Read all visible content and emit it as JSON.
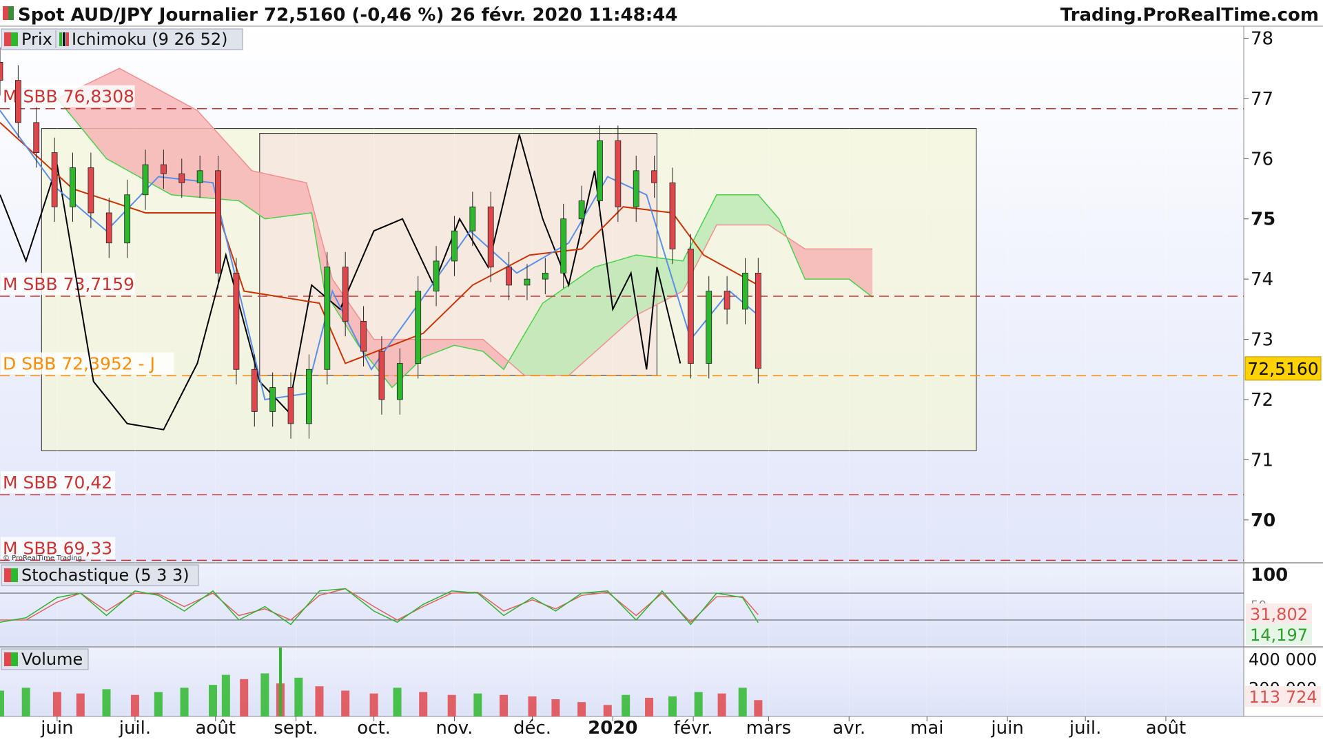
{
  "header": {
    "title": "Spot AUD/JPY Journalier 72,5160 (-0,46 %) 26 févr. 2020 11:48:44",
    "brand": "Trading.ProRealTime.com"
  },
  "legend": {
    "price": "Prix",
    "ichimoku": "Ichimoku (9 26 52)",
    "stochastic": "Stochastique (5 3 3)",
    "volume": "Volume",
    "copyright": "© ProRealTime Trading"
  },
  "colors": {
    "up": "#2eb82e",
    "down": "#e0474c",
    "kijun": "#cc3300",
    "tenkan": "#5b8ee6",
    "chikou": "#000000",
    "cloud_bull": "#bde9b5",
    "cloud_bear": "#f7b5b5",
    "level": "#cc3333",
    "current": "#ff8c00",
    "price_tag": "#ffd200"
  },
  "chart_data": [
    {
      "type": "candlestick",
      "ylim": [
        69.3,
        78.2
      ],
      "xlim": [
        "2019-05-10",
        "2020-08-31"
      ],
      "y_ticks": [
        "78",
        "77",
        "76",
        "75",
        "74",
        "73",
        "72",
        "71",
        "70"
      ],
      "bold_ticks": [
        "75",
        "70"
      ],
      "current_price": {
        "value": 72.516,
        "label": "72,5160"
      },
      "levels": [
        {
          "value": 76.8308,
          "label": "M SBB 76,8308",
          "kind": "major"
        },
        {
          "value": 73.7159,
          "label": "M SBB 73,7159",
          "kind": "major"
        },
        {
          "value": 72.3952,
          "label": "D SBB 72,3952 - J",
          "kind": "daily"
        },
        {
          "value": 70.42,
          "label": "M SBB 70,42",
          "kind": "major"
        },
        {
          "value": 69.33,
          "label": "M SBB 69,33",
          "kind": "major"
        }
      ],
      "zones": [
        {
          "from": "2019-05-26",
          "to": "2020-05-20",
          "low": 71.15,
          "high": 76.5
        },
        {
          "from": "2019-08-18",
          "to": "2020-01-18",
          "low": 72.4,
          "high": 76.42
        }
      ],
      "prices": [
        [
          "2019-05-10",
          77.3
        ],
        [
          "2019-05-17",
          76.6
        ],
        [
          "2019-05-24",
          76.1
        ],
        [
          "2019-05-31",
          75.2
        ],
        [
          "2019-06-07",
          75.85
        ],
        [
          "2019-06-14",
          75.1
        ],
        [
          "2019-06-21",
          74.6
        ],
        [
          "2019-06-28",
          75.4
        ],
        [
          "2019-07-05",
          75.9
        ],
        [
          "2019-07-12",
          75.75
        ],
        [
          "2019-07-19",
          75.6
        ],
        [
          "2019-07-26",
          75.8
        ],
        [
          "2019-08-02",
          74.1
        ],
        [
          "2019-08-09",
          72.5
        ],
        [
          "2019-08-16",
          71.8
        ],
        [
          "2019-08-23",
          72.2
        ],
        [
          "2019-08-30",
          71.6
        ],
        [
          "2019-09-06",
          72.5
        ],
        [
          "2019-09-13",
          74.2
        ],
        [
          "2019-09-20",
          73.3
        ],
        [
          "2019-09-27",
          72.8
        ],
        [
          "2019-10-04",
          72.0
        ],
        [
          "2019-10-11",
          72.6
        ],
        [
          "2019-10-18",
          73.8
        ],
        [
          "2019-10-25",
          74.3
        ],
        [
          "2019-11-01",
          74.8
        ],
        [
          "2019-11-08",
          75.2
        ],
        [
          "2019-11-15",
          74.2
        ],
        [
          "2019-11-22",
          73.9
        ],
        [
          "2019-11-29",
          74.0
        ],
        [
          "2019-12-06",
          74.1
        ],
        [
          "2019-12-13",
          75.0
        ],
        [
          "2019-12-20",
          75.3
        ],
        [
          "2019-12-27",
          76.3
        ],
        [
          "2020-01-03",
          75.2
        ],
        [
          "2020-01-10",
          75.8
        ],
        [
          "2020-01-17",
          75.6
        ],
        [
          "2020-01-24",
          74.5
        ],
        [
          "2020-01-31",
          72.6
        ],
        [
          "2020-02-07",
          73.8
        ],
        [
          "2020-02-14",
          73.5
        ],
        [
          "2020-02-21",
          74.1
        ],
        [
          "2020-02-26",
          72.516
        ]
      ],
      "chikou": [
        [
          "2019-05-10",
          75.4
        ],
        [
          "2019-05-20",
          74.3
        ],
        [
          "2019-06-01",
          75.9
        ],
        [
          "2019-06-15",
          72.3
        ],
        [
          "2019-06-28",
          71.6
        ],
        [
          "2019-07-12",
          71.5
        ],
        [
          "2019-07-25",
          72.6
        ],
        [
          "2019-08-05",
          74.4
        ],
        [
          "2019-08-18",
          72.3
        ],
        [
          "2019-08-29",
          71.8
        ],
        [
          "2019-09-07",
          73.9
        ],
        [
          "2019-09-18",
          73.5
        ],
        [
          "2019-10-01",
          74.8
        ],
        [
          "2019-10-12",
          75.0
        ],
        [
          "2019-10-24",
          73.9
        ],
        [
          "2019-11-03",
          75.0
        ],
        [
          "2019-11-14",
          74.2
        ],
        [
          "2019-11-26",
          76.4
        ],
        [
          "2019-12-05",
          75.0
        ],
        [
          "2019-12-15",
          73.9
        ],
        [
          "2019-12-25",
          75.8
        ],
        [
          "2020-01-01",
          73.5
        ],
        [
          "2020-01-08",
          74.1
        ],
        [
          "2020-01-14",
          72.5
        ],
        [
          "2020-01-18",
          74.2
        ],
        [
          "2020-01-27",
          72.6
        ]
      ],
      "tenkan": [
        [
          "2019-05-10",
          76.8
        ],
        [
          "2019-06-01",
          75.5
        ],
        [
          "2019-06-20",
          74.8
        ],
        [
          "2019-07-10",
          75.7
        ],
        [
          "2019-07-31",
          75.6
        ],
        [
          "2019-08-20",
          72.0
        ],
        [
          "2019-09-05",
          72.1
        ],
        [
          "2019-09-15",
          73.8
        ],
        [
          "2019-09-30",
          72.5
        ],
        [
          "2019-10-20",
          73.7
        ],
        [
          "2019-11-07",
          74.8
        ],
        [
          "2019-11-25",
          74.1
        ],
        [
          "2019-12-15",
          74.6
        ],
        [
          "2019-12-30",
          75.7
        ],
        [
          "2020-01-14",
          75.4
        ],
        [
          "2020-01-31",
          73.0
        ],
        [
          "2020-02-15",
          73.8
        ],
        [
          "2020-02-26",
          73.4
        ]
      ],
      "kijun": [
        [
          "2019-05-10",
          76.6
        ],
        [
          "2019-06-07",
          75.5
        ],
        [
          "2019-07-05",
          75.1
        ],
        [
          "2019-08-02",
          75.1
        ],
        [
          "2019-08-12",
          73.8
        ],
        [
          "2019-09-10",
          73.6
        ],
        [
          "2019-09-20",
          72.6
        ],
        [
          "2019-10-20",
          73.1
        ],
        [
          "2019-11-08",
          73.9
        ],
        [
          "2019-11-30",
          74.4
        ],
        [
          "2019-12-20",
          74.5
        ],
        [
          "2020-01-05",
          75.2
        ],
        [
          "2020-01-24",
          75.1
        ],
        [
          "2020-02-05",
          74.4
        ],
        [
          "2020-02-26",
          73.9
        ]
      ],
      "senkou_a": [
        [
          "2019-06-01",
          77.0
        ],
        [
          "2019-06-20",
          76.0
        ],
        [
          "2019-07-15",
          75.4
        ],
        [
          "2019-08-10",
          75.3
        ],
        [
          "2019-08-20",
          75.0
        ],
        [
          "2019-09-07",
          75.1
        ],
        [
          "2019-09-12",
          73.8
        ],
        [
          "2019-09-25",
          72.9
        ],
        [
          "2019-10-08",
          72.2
        ],
        [
          "2019-10-20",
          72.7
        ],
        [
          "2019-11-01",
          72.9
        ],
        [
          "2019-11-12",
          72.8
        ],
        [
          "2019-11-20",
          72.5
        ],
        [
          "2019-12-05",
          73.6
        ],
        [
          "2019-12-25",
          74.2
        ],
        [
          "2020-01-10",
          74.4
        ],
        [
          "2020-01-28",
          74.3
        ],
        [
          "2020-02-10",
          75.4
        ],
        [
          "2020-02-26",
          75.4
        ],
        [
          "2020-03-05",
          75.0
        ],
        [
          "2020-03-15",
          74.0
        ],
        [
          "2020-04-01",
          74.0
        ],
        [
          "2020-04-10",
          73.7
        ]
      ],
      "senkou_b": [
        [
          "2019-06-01",
          77.0
        ],
        [
          "2019-06-25",
          77.5
        ],
        [
          "2019-07-25",
          76.8
        ],
        [
          "2019-08-15",
          75.8
        ],
        [
          "2019-09-05",
          75.6
        ],
        [
          "2019-09-15",
          74.0
        ],
        [
          "2019-10-01",
          73.0
        ],
        [
          "2019-10-20",
          73.0
        ],
        [
          "2019-11-12",
          73.0
        ],
        [
          "2019-11-28",
          72.4
        ],
        [
          "2019-12-15",
          72.4
        ],
        [
          "2020-01-10",
          73.4
        ],
        [
          "2020-01-28",
          73.8
        ],
        [
          "2020-02-10",
          74.9
        ],
        [
          "2020-03-01",
          74.9
        ],
        [
          "2020-03-15",
          74.5
        ],
        [
          "2020-04-10",
          74.5
        ]
      ]
    },
    {
      "type": "line",
      "name": "stochastique",
      "ylim": [
        0,
        100
      ],
      "y_ticks": [
        "100",
        "50"
      ],
      "bands": [
        80,
        20
      ],
      "last_values": [
        {
          "label": "31,802"
        },
        {
          "label": "14,197"
        }
      ],
      "k": [
        [
          "2019-05-10",
          15
        ],
        [
          "2019-05-20",
          25
        ],
        [
          "2019-06-01",
          70
        ],
        [
          "2019-06-10",
          80
        ],
        [
          "2019-06-20",
          30
        ],
        [
          "2019-07-01",
          85
        ],
        [
          "2019-07-10",
          75
        ],
        [
          "2019-07-20",
          40
        ],
        [
          "2019-07-31",
          85
        ],
        [
          "2019-08-10",
          20
        ],
        [
          "2019-08-20",
          50
        ],
        [
          "2019-08-30",
          10
        ],
        [
          "2019-09-10",
          85
        ],
        [
          "2019-09-20",
          90
        ],
        [
          "2019-10-01",
          40
        ],
        [
          "2019-10-10",
          15
        ],
        [
          "2019-10-20",
          55
        ],
        [
          "2019-10-31",
          85
        ],
        [
          "2019-11-10",
          80
        ],
        [
          "2019-11-20",
          30
        ],
        [
          "2019-12-01",
          70
        ],
        [
          "2019-12-10",
          40
        ],
        [
          "2019-12-20",
          80
        ],
        [
          "2019-12-30",
          85
        ],
        [
          "2020-01-10",
          20
        ],
        [
          "2020-01-20",
          85
        ],
        [
          "2020-01-31",
          10
        ],
        [
          "2020-02-10",
          80
        ],
        [
          "2020-02-20",
          70
        ],
        [
          "2020-02-26",
          14.197
        ]
      ],
      "d": [
        [
          "2019-05-10",
          20
        ],
        [
          "2019-05-20",
          20
        ],
        [
          "2019-06-01",
          60
        ],
        [
          "2019-06-10",
          80
        ],
        [
          "2019-06-20",
          40
        ],
        [
          "2019-07-01",
          80
        ],
        [
          "2019-07-10",
          78
        ],
        [
          "2019-07-20",
          50
        ],
        [
          "2019-07-31",
          80
        ],
        [
          "2019-08-10",
          30
        ],
        [
          "2019-08-20",
          45
        ],
        [
          "2019-08-30",
          20
        ],
        [
          "2019-09-10",
          75
        ],
        [
          "2019-09-20",
          90
        ],
        [
          "2019-10-01",
          50
        ],
        [
          "2019-10-10",
          20
        ],
        [
          "2019-10-20",
          50
        ],
        [
          "2019-10-31",
          80
        ],
        [
          "2019-11-10",
          82
        ],
        [
          "2019-11-20",
          40
        ],
        [
          "2019-12-01",
          65
        ],
        [
          "2019-12-10",
          45
        ],
        [
          "2019-12-20",
          75
        ],
        [
          "2019-12-30",
          82
        ],
        [
          "2020-01-10",
          30
        ],
        [
          "2020-01-20",
          80
        ],
        [
          "2020-01-31",
          15
        ],
        [
          "2020-02-10",
          72
        ],
        [
          "2020-02-20",
          72
        ],
        [
          "2020-02-26",
          31.802
        ]
      ]
    },
    {
      "type": "bar",
      "name": "volume",
      "ylim": [
        0,
        480000
      ],
      "y_ticks": [
        "400 000",
        "200 000"
      ],
      "last_value": {
        "value": 113724,
        "label": "113 724"
      },
      "x": [
        "2019-05-10",
        "2019-05-20",
        "2019-06-01",
        "2019-06-10",
        "2019-06-20",
        "2019-07-01",
        "2019-07-10",
        "2019-07-20",
        "2019-07-31",
        "2019-08-05",
        "2019-08-12",
        "2019-08-20",
        "2019-08-26",
        "2019-09-02",
        "2019-09-10",
        "2019-09-20",
        "2019-10-01",
        "2019-10-10",
        "2019-10-20",
        "2019-10-31",
        "2019-11-10",
        "2019-11-20",
        "2019-12-01",
        "2019-12-10",
        "2019-12-20",
        "2019-12-30",
        "2020-01-06",
        "2020-01-15",
        "2020-01-24",
        "2020-02-03",
        "2020-02-12",
        "2020-02-20",
        "2020-02-26"
      ],
      "values": [
        180000,
        200000,
        170000,
        160000,
        190000,
        150000,
        170000,
        200000,
        220000,
        290000,
        260000,
        300000,
        230000,
        270000,
        210000,
        180000,
        160000,
        200000,
        170000,
        150000,
        160000,
        150000,
        140000,
        120000,
        100000,
        80000,
        150000,
        130000,
        140000,
        170000,
        160000,
        200000,
        113724
      ],
      "peak": {
        "x": "2019-08-26",
        "value": 480000
      }
    }
  ],
  "x_axis": {
    "months": [
      {
        "date": "2019-06-01",
        "label": "juin"
      },
      {
        "date": "2019-07-01",
        "label": "juil."
      },
      {
        "date": "2019-08-01",
        "label": "août"
      },
      {
        "date": "2019-09-01",
        "label": "sept."
      },
      {
        "date": "2019-10-01",
        "label": "oct."
      },
      {
        "date": "2019-11-01",
        "label": "nov."
      },
      {
        "date": "2019-12-01",
        "label": "déc."
      },
      {
        "date": "2020-01-01",
        "label": "2020",
        "bold": true
      },
      {
        "date": "2020-02-01",
        "label": "févr."
      },
      {
        "date": "2020-03-01",
        "label": "mars"
      },
      {
        "date": "2020-04-01",
        "label": "avr."
      },
      {
        "date": "2020-05-01",
        "label": "mai"
      },
      {
        "date": "2020-06-01",
        "label": "juin"
      },
      {
        "date": "2020-07-01",
        "label": "juil."
      },
      {
        "date": "2020-08-01",
        "label": "août"
      }
    ]
  }
}
